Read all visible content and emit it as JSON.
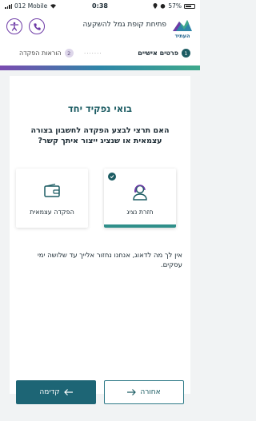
{
  "status_bar": {
    "carrier": "012 Mobile",
    "time": "0:38",
    "battery": "57%"
  },
  "header": {
    "title": "פתיחת קופת גמל להשקעה",
    "logo_text": "העתיד",
    "icons": [
      "accessibility-icon",
      "phone-icon"
    ]
  },
  "steps": [
    {
      "number": "1",
      "label": "פרטים אישיים",
      "active": true
    },
    {
      "number": "2",
      "label": "הוראות הפקדה",
      "active": false
    }
  ],
  "main": {
    "title": "בואי נפקיד יחד",
    "question": "האם תרצי לבצע הפקדה לחשבון בצורה עצמאית או שנציג ייצור איתך קשר?",
    "options": [
      {
        "label": "חזרת נציג",
        "icon": "headset-agent-icon",
        "selected": true
      },
      {
        "label": "הפקדה עצמאית",
        "icon": "wallet-icon",
        "selected": false
      }
    ],
    "info": "אין לך מה לדאוג, אנחנו נחזור אלייך עד שלושה ימי עסקים."
  },
  "buttons": {
    "back": "אחורה",
    "next": "קדימה"
  },
  "colors": {
    "primary": "#1c5c63",
    "accent_purple": "#6d3aa6",
    "next_button": "#1d6575"
  }
}
